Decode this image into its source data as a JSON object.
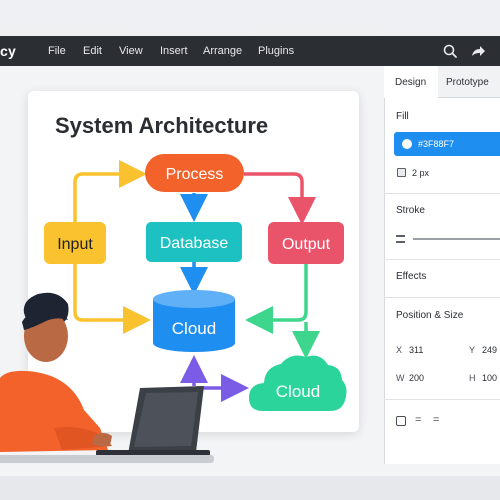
{
  "app": {
    "title": "cy"
  },
  "menu": [
    "File",
    "Edit",
    "View",
    "Insert",
    "Arrange",
    "Plugins"
  ],
  "toolbar_icons": [
    "search-icon",
    "share-icon"
  ],
  "diagram": {
    "title": "System Architecture",
    "nodes": {
      "process": "Process",
      "input": "Input",
      "database": "Database",
      "output": "Output",
      "cloud_db": "Cloud",
      "cloud": "Cloud"
    },
    "colors": {
      "process": "#F4622C",
      "input": "#F9C22E",
      "database": "#1EC1C1",
      "output": "#E9546B",
      "cloud_db": "#1F8EF1",
      "cloud": "#2BD49A",
      "arrow_blue": "#1F8EF1",
      "arrow_green": "#3DD68C",
      "arrow_purple": "#7B5CE6"
    }
  },
  "panel": {
    "tabs": [
      "Design",
      "Prototype"
    ],
    "active_tab": "Design",
    "fill": {
      "title": "Fill",
      "value": "#3F88F7"
    },
    "border": {
      "value": "2 px"
    },
    "stroke": {
      "title": "Stroke"
    },
    "effects": {
      "title": "Effects"
    },
    "position": {
      "title": "Position & Size",
      "x_label": "X",
      "x": "311",
      "y_label": "Y",
      "y": "249",
      "w_label": "W",
      "w": "200",
      "h_label": "H",
      "h": "100"
    },
    "align_symbols": [
      "=",
      "="
    ]
  }
}
